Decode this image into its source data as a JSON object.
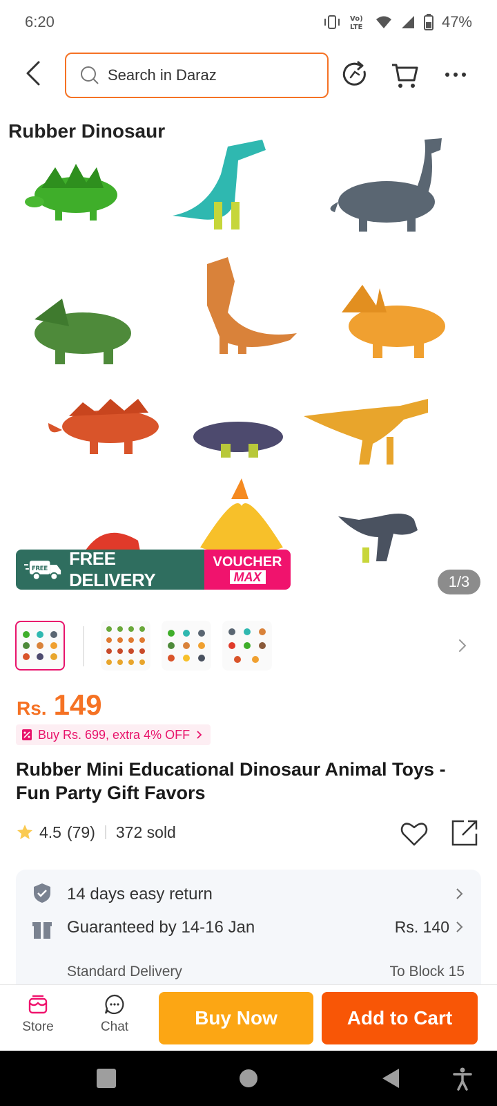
{
  "status_bar": {
    "time": "6:20",
    "battery": "47%",
    "network_label": "Vo) LTE"
  },
  "header": {
    "search_placeholder": "Search in Daraz"
  },
  "gallery": {
    "title": "Rubber Dinosaur",
    "promo_free": "FREE DELIVERY",
    "promo_free_tag": "FREE",
    "promo_voucher_line1": "VOUCHER",
    "promo_voucher_line2": "MAX",
    "counter": "1/3"
  },
  "product": {
    "currency": "Rs.",
    "price": "149",
    "promo": "Buy Rs. 699, extra 4% OFF",
    "title": "Rubber Mini Educational Dinosaur Animal Toys - Fun Party Gift Favors",
    "rating": "4.5",
    "reviews": "(79)",
    "sold": "372 sold"
  },
  "info": {
    "return_text": "14 days easy return",
    "delivery_text": "Guaranteed by 14-16 Jan",
    "delivery_price": "Rs. 140",
    "delivery_type": "Standard Delivery",
    "delivery_location": "To Block 15"
  },
  "bottom": {
    "store": "Store",
    "chat": "Chat",
    "buy_now": "Buy Now",
    "add_to_cart": "Add to Cart"
  },
  "colors": {
    "accent": "#f57224",
    "buy": "#fca614",
    "cart": "#f85606",
    "pink": "#e8136b",
    "green": "#2f6e5f"
  }
}
